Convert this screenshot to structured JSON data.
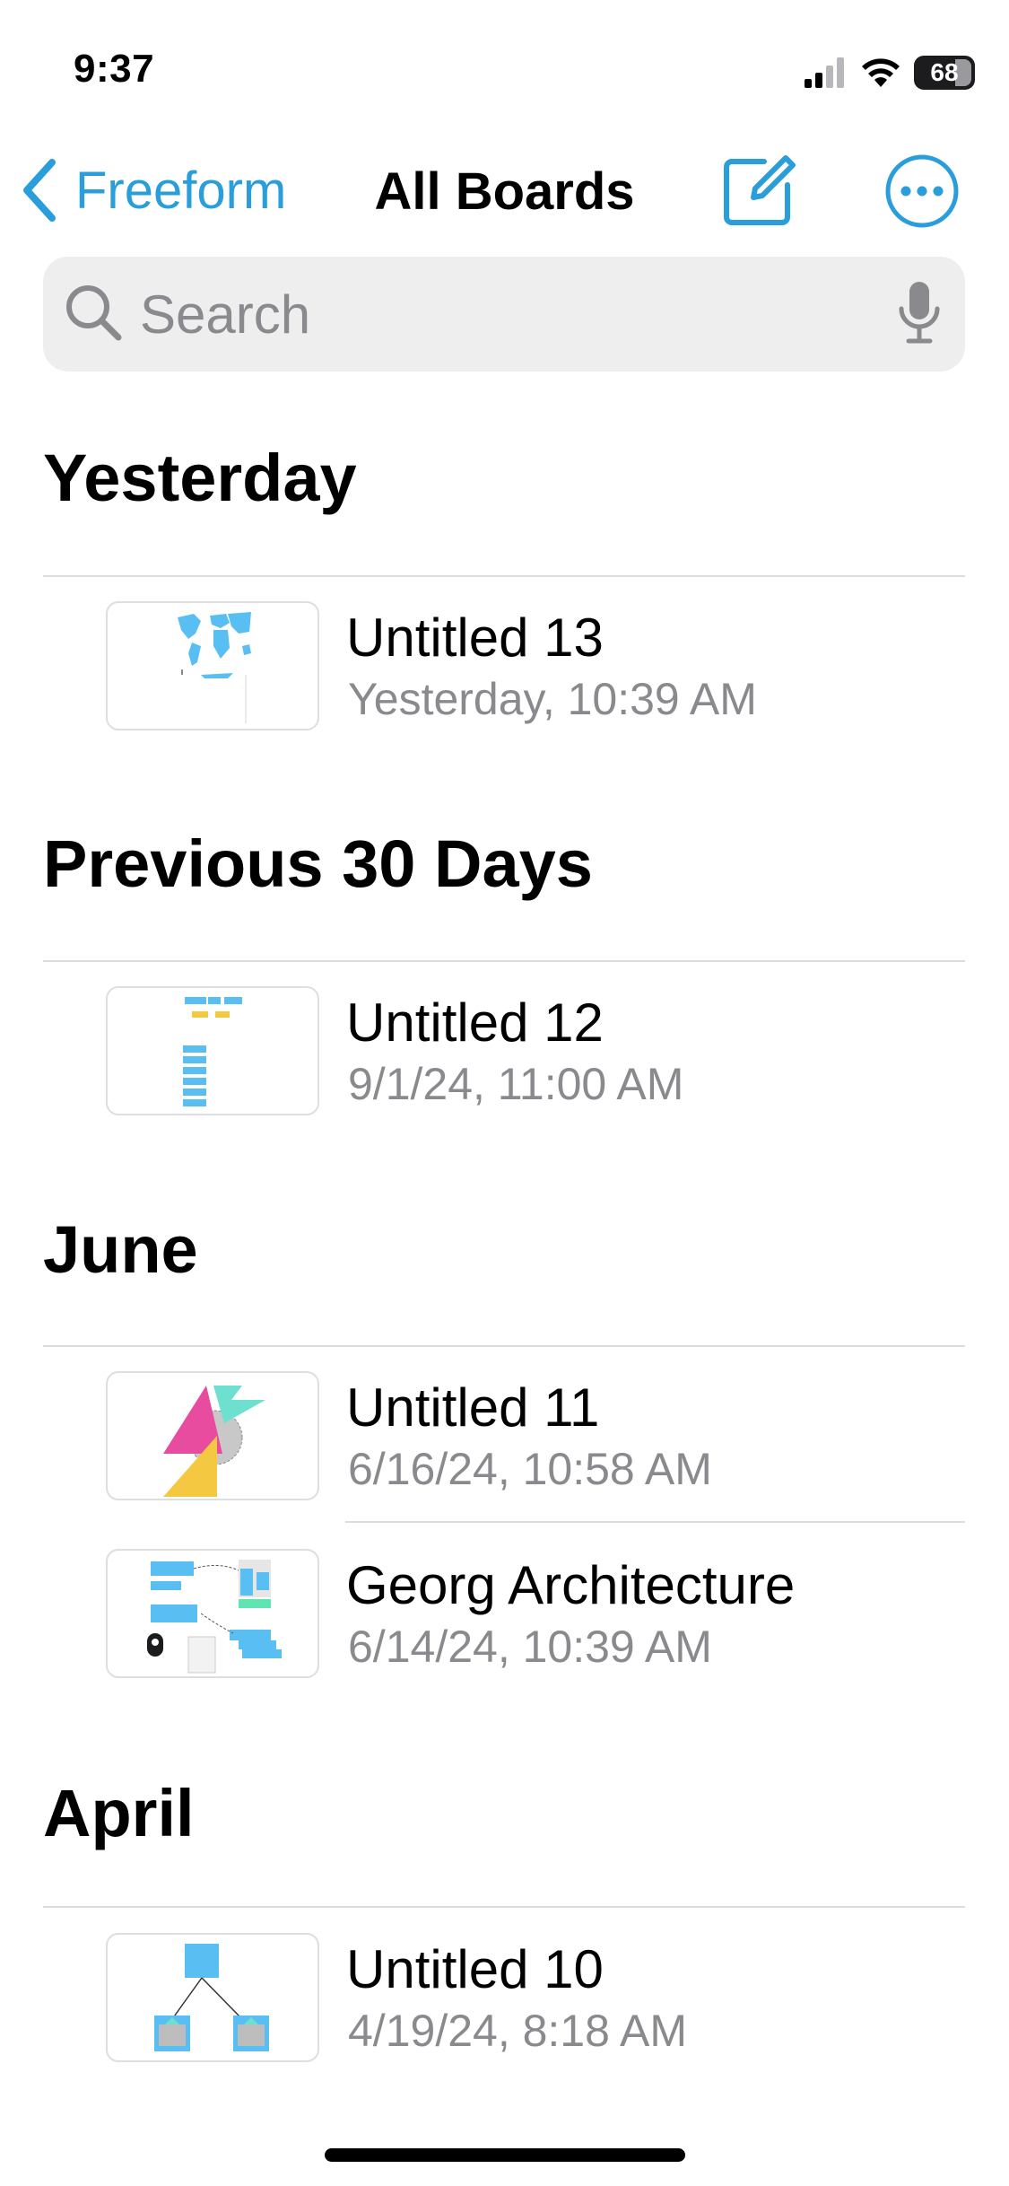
{
  "status_bar": {
    "time": "9:37",
    "battery_level": "68",
    "icons": [
      "cellular-signal-icon",
      "wifi-icon",
      "battery-icon"
    ]
  },
  "nav": {
    "back_label": "Freeform",
    "title": "All Boards",
    "compose_icon": "compose-icon",
    "more_icon": "ellipsis-circle-icon"
  },
  "search": {
    "placeholder": "Search",
    "value": ""
  },
  "colors": {
    "accent": "#2a9ddb",
    "secondary_text": "#8a8a8e",
    "search_bg": "#eeeeef"
  },
  "sections": [
    {
      "header": "Yesterday",
      "boards": [
        {
          "title": "Untitled 13",
          "date": "Yesterday, 10:39 AM"
        }
      ]
    },
    {
      "header": "Previous 30 Days",
      "boards": [
        {
          "title": "Untitled 12",
          "date": "9/1/24, 11:00 AM"
        }
      ]
    },
    {
      "header": "June",
      "boards": [
        {
          "title": "Untitled 11",
          "date": "6/16/24, 10:58 AM"
        },
        {
          "title": "Georg Architecture",
          "date": "6/14/24, 10:39 AM"
        }
      ]
    },
    {
      "header": "April",
      "boards": [
        {
          "title": "Untitled 10",
          "date": "4/19/24, 8:18 AM"
        }
      ]
    }
  ]
}
